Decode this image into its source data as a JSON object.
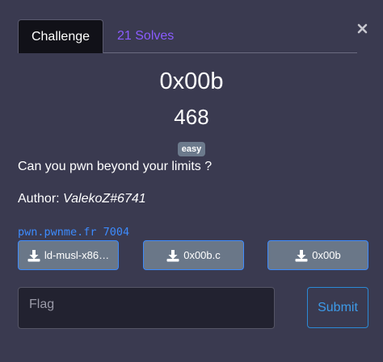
{
  "tabs": [
    {
      "label": "Challenge",
      "active": true
    },
    {
      "label": "21 Solves",
      "active": false
    }
  ],
  "close_symbol": "×",
  "challenge": {
    "name": "0x00b",
    "points": "468",
    "difficulty": "easy",
    "description": "Can you pwn beyond your limits ?",
    "author_label": "Author:",
    "author": "ValekoZ#6741",
    "connection": "pwn.pwnme.fr 7004"
  },
  "files": [
    {
      "label": "ld-musl-x86…",
      "icon": "download-icon"
    },
    {
      "label": "0x00b.c",
      "icon": "download-icon"
    },
    {
      "label": "0x00b",
      "icon": "download-icon"
    }
  ],
  "flag_form": {
    "placeholder": "Flag",
    "value": "",
    "submit_label": "Submit"
  },
  "colors": {
    "background": "#3a3a50",
    "tab_active_bg": "#111118",
    "tab_inactive_text": "#8a5cff",
    "link": "#3d8bfd",
    "file_button_bg": "#6a7788",
    "badge_bg": "#6c7a8c",
    "submit_border": "#2b8ad6"
  }
}
